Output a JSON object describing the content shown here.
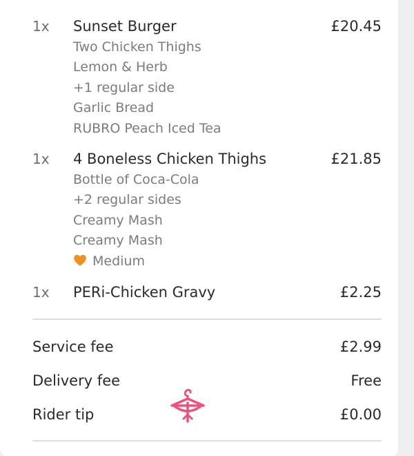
{
  "items": [
    {
      "qty": "1x",
      "name": "Sunset Burger",
      "price": "£20.45",
      "options": [
        "Two Chicken Thighs",
        "Lemon & Herb",
        "+1 regular side",
        "Garlic Bread",
        "RUBRO Peach Iced Tea"
      ]
    },
    {
      "qty": "1x",
      "name": "4 Boneless Chicken Thighs",
      "price": "£21.85",
      "options": [
        "Bottle of Coca-Cola",
        "+2 regular sides",
        "Creamy Mash",
        "Creamy Mash"
      ],
      "spice_label": "Medium",
      "spice_icon": "orange-heart-icon",
      "spice_color": "#f0901e"
    },
    {
      "qty": "1x",
      "name": "PERi-Chicken Gravy",
      "price": "£2.25",
      "options": []
    }
  ],
  "fees": {
    "service_label": "Service fee",
    "service_value": "£2.99",
    "delivery_label": "Delivery fee",
    "delivery_value": "Free",
    "tip_label": "Rider tip",
    "tip_value": "£0.00"
  },
  "watermark_icon": "hanger-bow-icon",
  "watermark_color": "#f0507a"
}
